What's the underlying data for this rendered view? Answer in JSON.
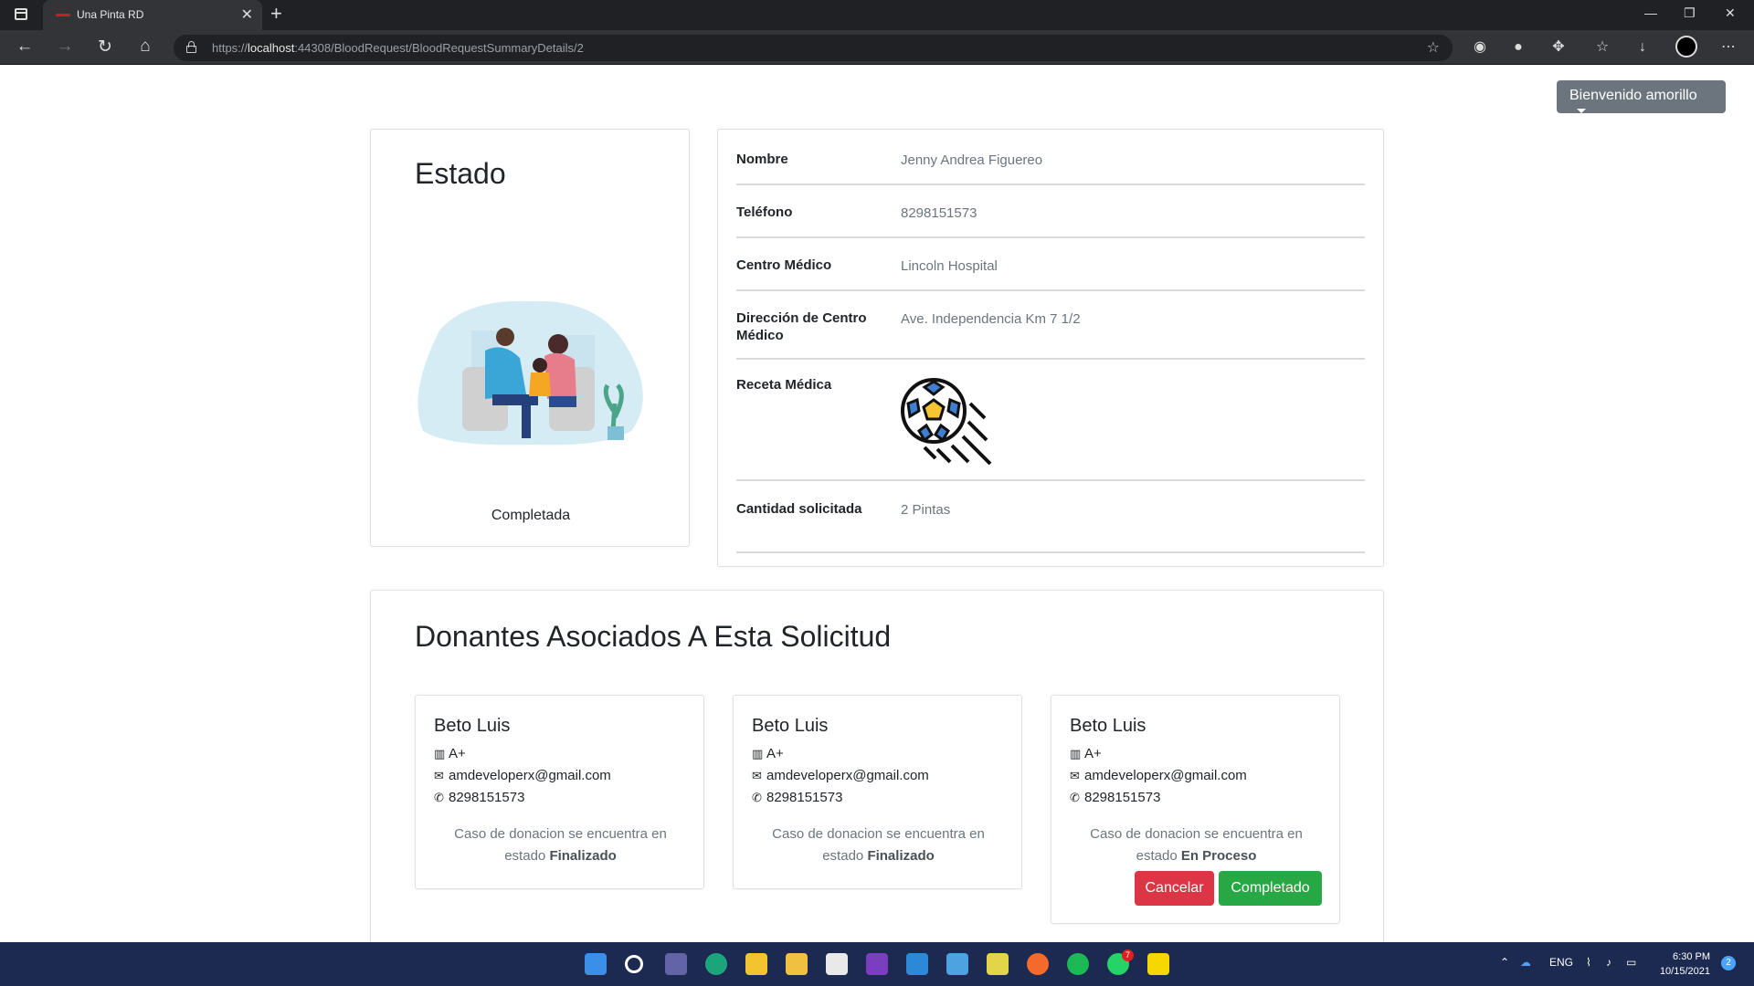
{
  "browser": {
    "tab_title": "Una Pinta RD",
    "url_prefix": "https://",
    "url_host": "localhost",
    "url_rest": ":44308/BloodRequest/BloodRequestSummaryDetails/2"
  },
  "header": {
    "user_menu_label": "Bienvenido amorillo"
  },
  "status": {
    "title": "Estado",
    "value": "Completada"
  },
  "details": {
    "rows": [
      {
        "label": "Nombre",
        "value": "Jenny Andrea Figuereo"
      },
      {
        "label": "Teléfono",
        "value": "8298151573"
      },
      {
        "label": "Centro Médico",
        "value": "Lincoln Hospital"
      },
      {
        "label": "Dirección de Centro Médico",
        "value": "Ave. Independencia Km 7 1/2"
      },
      {
        "label": "Receta Médica",
        "value": ""
      },
      {
        "label": "Cantidad solicitada",
        "value": "2 Pintas"
      }
    ]
  },
  "donors": {
    "title": "Donantes Asociados A Esta Solicitud",
    "items": [
      {
        "name": "Beto Luis",
        "blood_type": "A+",
        "email": "amdeveloperx@gmail.com",
        "phone": "8298151573",
        "status_prefix": "Caso de donacion se encuentra en estado",
        "status": "Finalizado"
      },
      {
        "name": "Beto Luis",
        "blood_type": "A+",
        "email": "amdeveloperx@gmail.com",
        "phone": "8298151573",
        "status_prefix": "Caso de donacion se encuentra en estado",
        "status": "Finalizado"
      },
      {
        "name": "Beto Luis",
        "blood_type": "A+",
        "email": "amdeveloperx@gmail.com",
        "phone": "8298151573",
        "status_prefix": "Caso de donacion se encuentra en estado",
        "status": "En Proceso",
        "cancel_label": "Cancelar",
        "complete_label": "Completado"
      }
    ]
  },
  "taskbar": {
    "language": "ENG",
    "time": "6:30 PM",
    "date": "10/15/2021",
    "notification_count": "2",
    "whatsapp_badge": "7"
  },
  "colors": {
    "danger": "#dc3545",
    "success": "#28a745",
    "secondary": "#6c757d"
  }
}
